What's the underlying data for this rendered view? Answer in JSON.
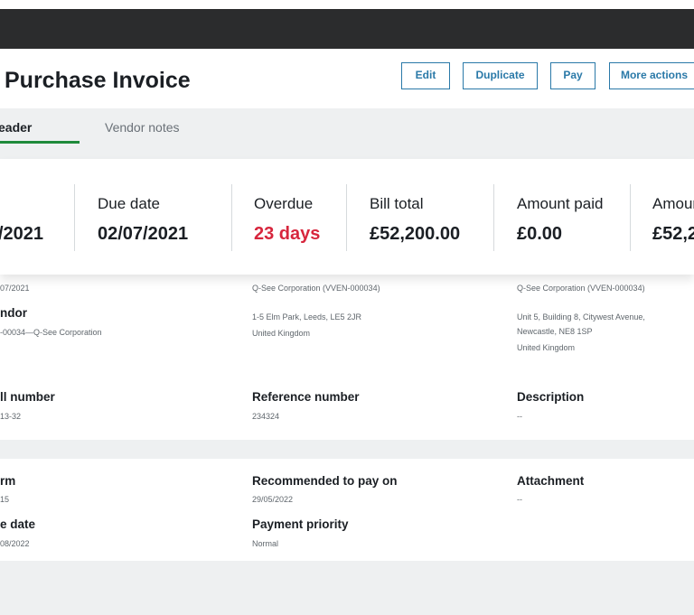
{
  "page": {
    "title": "Purchase Invoice"
  },
  "actions": {
    "edit": "Edit",
    "duplicate": "Duplicate",
    "pay": "Pay",
    "more": "More actions"
  },
  "tabs": {
    "active": "eader",
    "inactive": "Vendor notes"
  },
  "summary": {
    "date_value": "/2021",
    "due_date_label": "Due date",
    "due_date_value": "02/07/2021",
    "overdue_label": "Overdue",
    "overdue_value": "23 days",
    "bill_total_label": "Bill total",
    "bill_total_value": "£52,200.00",
    "amount_paid_label": "Amount paid",
    "amount_paid_value": "£0.00",
    "amount_due_label": "Amour",
    "amount_due_value": "£52,2"
  },
  "details": {
    "top_date": "07/2021",
    "vendor_label": "ndor",
    "vendor_value": "-00034—Q-See Corporation",
    "vendor_addr_title": "Q-See Corporation (VVEN-000034)",
    "vendor_addr_line1": "1-5 Elm Park, Leeds, LE5 2JR",
    "vendor_addr_line2": "United Kingdom",
    "remit_addr_title": "Q-See Corporation (VVEN-000034)",
    "remit_addr_line1": "Unit 5, Building 8, Citywest Avenue,",
    "remit_addr_line2": "Newcastle, NE8 1SP",
    "remit_addr_line3": "United Kingdom",
    "bill_number_label": "ll number",
    "bill_number_value": "13-32",
    "reference_label": "Reference number",
    "reference_value": "234324",
    "description_label": "Description",
    "description_value": "--"
  },
  "payment": {
    "term_label": "rm",
    "term_value": "15",
    "recommended_label": "Recommended to pay on",
    "recommended_value": "29/05/2022",
    "attachment_label": "Attachment",
    "attachment_value": "--",
    "due_date_label": "e date",
    "due_date_value": "08/2022",
    "priority_label": "Payment priority",
    "priority_value": "Normal"
  }
}
